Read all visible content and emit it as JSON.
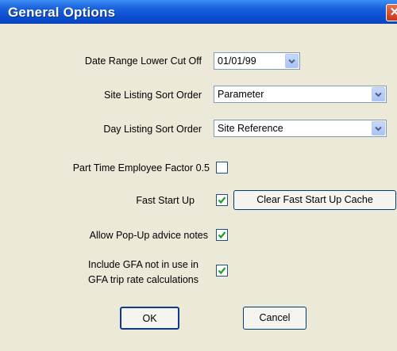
{
  "window": {
    "title": "General Options",
    "close_glyph": "✕"
  },
  "fields": {
    "date_range_label": "Date Range Lower Cut Off",
    "date_range_value": "01/01/99",
    "site_sort_label": "Site Listing Sort Order",
    "site_sort_value": "Parameter",
    "day_sort_label": "Day Listing Sort Order",
    "day_sort_value": "Site Reference",
    "part_time_label": "Part Time Employee Factor 0.5",
    "part_time_checked": false,
    "fast_start_label": "Fast Start Up",
    "fast_start_checked": true,
    "clear_cache_label": "Clear Fast Start Up Cache",
    "popup_label": "Allow Pop-Up advice notes",
    "popup_checked": true,
    "gfa_label_line1": "Include GFA not in use in",
    "gfa_label_line2": "GFA trip rate calculations",
    "gfa_checked": true
  },
  "buttons": {
    "ok_label": "OK",
    "cancel_label": "Cancel"
  },
  "colors": {
    "title_bar": "#0a4fd0",
    "dialog_bg": "#ece9d8",
    "check_green": "#21a121"
  },
  "icons": {
    "dropdown": "chevron-down-icon",
    "check": "check-icon",
    "close": "close-icon"
  }
}
